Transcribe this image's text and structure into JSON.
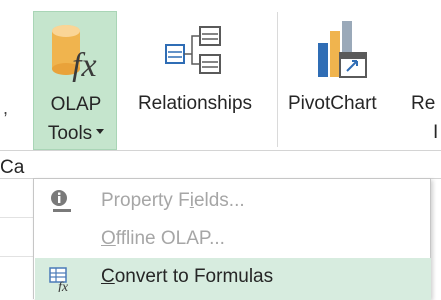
{
  "ribbon": {
    "olap_tools": {
      "line1": "OLAP",
      "line2": "Tools",
      "icon": "olap-cube-fx-icon"
    },
    "relationships": {
      "label": "Relationships",
      "icon": "relationships-icon"
    },
    "pivotchart": {
      "label": "PivotChart",
      "icon": "pivotchart-icon"
    },
    "cut_right_top": "Re",
    "cut_right_mid": "I",
    "cut_left_comma": ",",
    "cut_left_ca": "Ca"
  },
  "menu": {
    "items": [
      {
        "pre": "Property F",
        "accel": "i",
        "post": "elds...",
        "icon": "info-icon",
        "enabled": false
      },
      {
        "pre": "",
        "accel": "O",
        "post": "ffline OLAP...",
        "icon": "",
        "enabled": false
      },
      {
        "pre": "",
        "accel": "C",
        "post": "onvert to Formulas",
        "icon": "convert-formulas-icon",
        "enabled": true,
        "hover": true
      }
    ]
  },
  "colors": {
    "selected_button_bg": "#c5e5cd",
    "menu_hover_bg": "#d7ecdf",
    "disabled_text": "#a6a6a6"
  }
}
